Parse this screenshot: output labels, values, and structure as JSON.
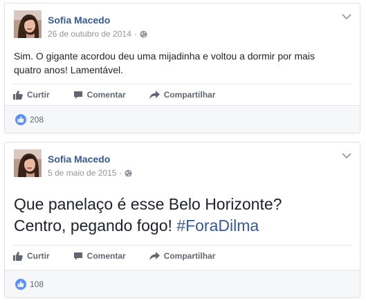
{
  "posts": [
    {
      "author": "Sofia Macedo",
      "date": "26 de outubro de 2014",
      "separator": "·",
      "text_lines": [
        "Sim. O gigante acordou deu uma mijadinha e voltou a dormir por mais",
        "quatro anos! Lamentável."
      ],
      "actions": {
        "like": "Curtir",
        "comment": "Comentar",
        "share": "Compartilhar"
      },
      "likes": "208"
    },
    {
      "author": "Sofia Macedo",
      "date": "5 de maio de 2015",
      "separator": "·",
      "text_lines": [
        "Que panelaço é esse Belo Horizonte?",
        "Centro, pegando fogo!"
      ],
      "hashtag": "#ForaDilma",
      "actions": {
        "like": "Curtir",
        "comment": "Comentar",
        "share": "Compartilhar"
      },
      "likes": "108"
    }
  ],
  "colors": {
    "author_link": "#365899",
    "secondary_text": "#90949c",
    "action_text": "#606770",
    "like_badge": "#5890ff",
    "footer_bg": "#f6f7f9"
  },
  "icons": [
    "chevron-down-icon",
    "globe-icon",
    "thumbs-up-icon",
    "comment-icon",
    "share-icon",
    "like-badge-icon"
  ]
}
